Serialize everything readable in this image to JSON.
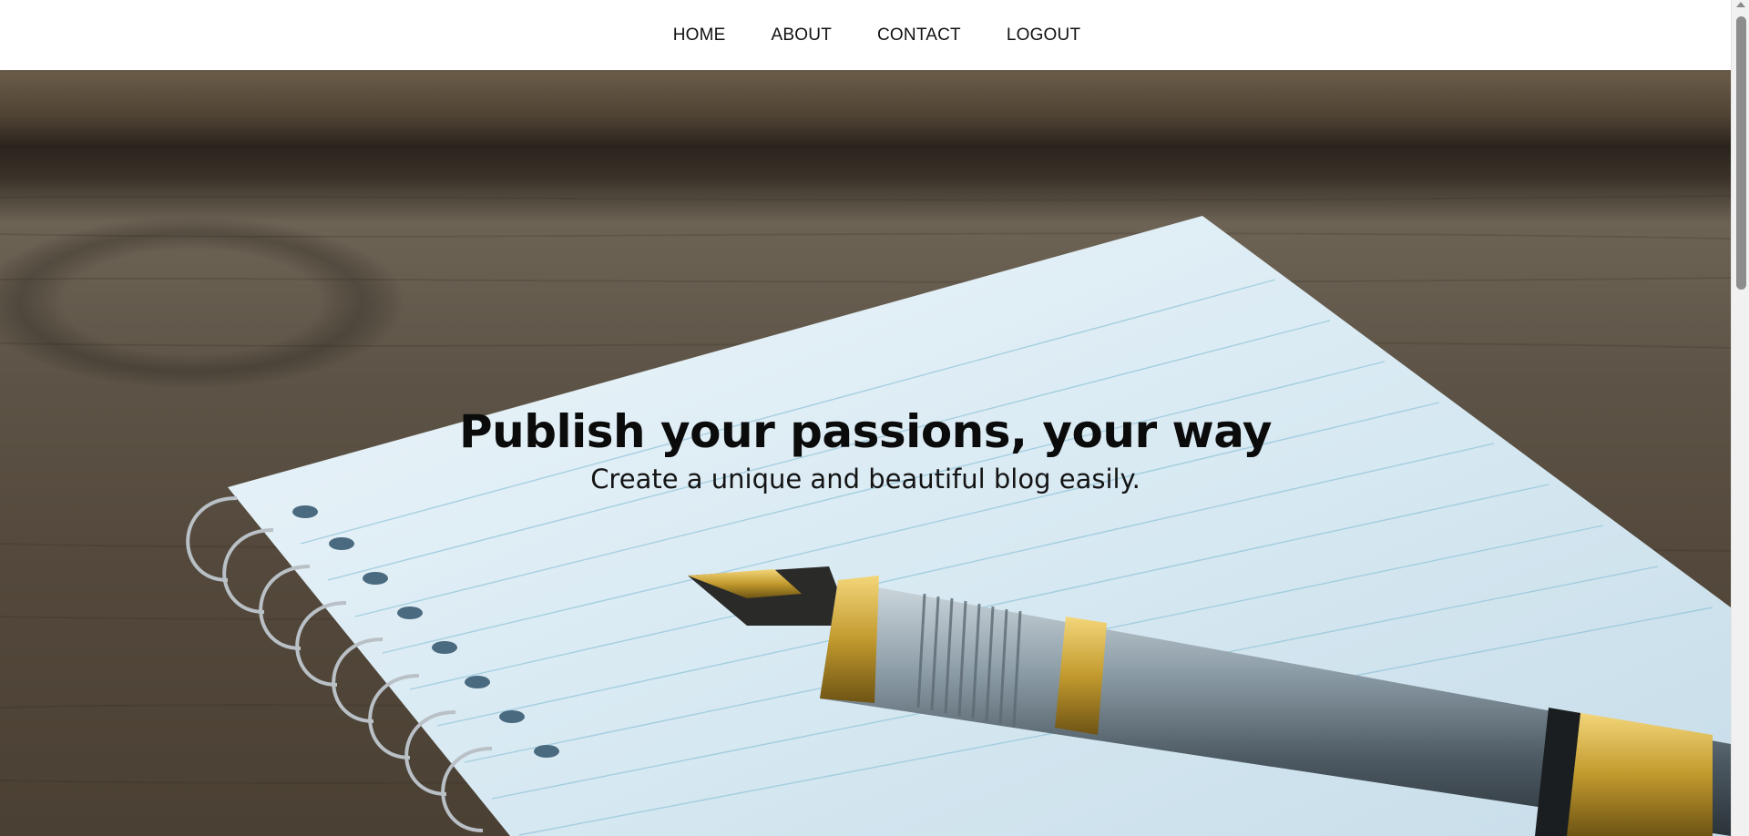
{
  "nav": {
    "items": [
      {
        "label": "HOME"
      },
      {
        "label": "ABOUT"
      },
      {
        "label": "CONTACT"
      },
      {
        "label": "LOGOUT"
      }
    ]
  },
  "hero": {
    "title": "Publish your passions, your way",
    "subtitle": "Create a unique and beautiful blog easily.",
    "image": "notebook-and-fountain-pen-on-wooden-desk"
  },
  "colors": {
    "nav_background": "#ffffff",
    "nav_text": "#111111",
    "hero_text": "#0b0b0b",
    "wood": "#5d5447",
    "paper": "#dcebf3",
    "pen_gold": "#c9a23a"
  }
}
